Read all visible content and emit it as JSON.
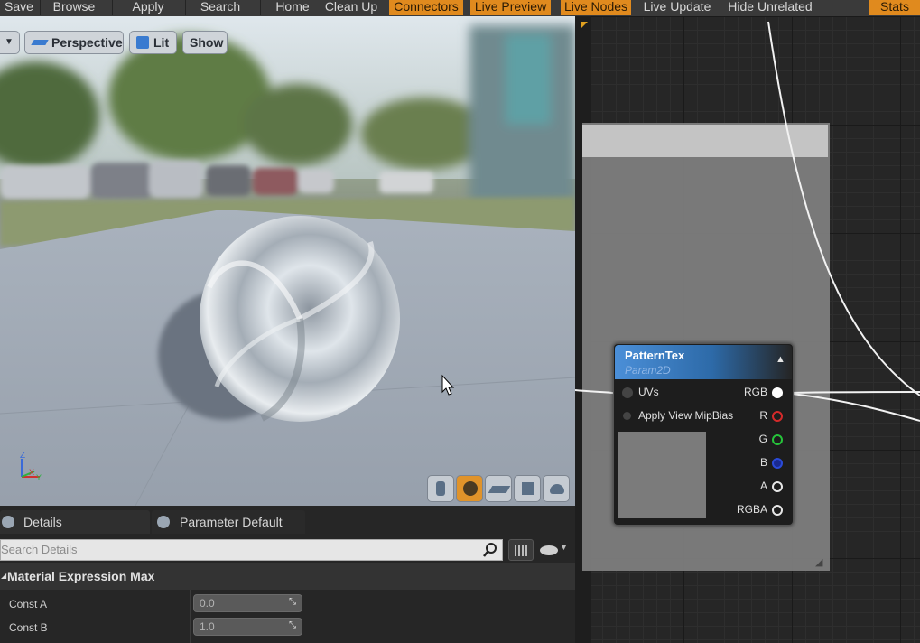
{
  "toolbar": {
    "buttons": [
      {
        "label": "Save",
        "active": false
      },
      {
        "label": "Browse",
        "active": false
      },
      {
        "label": "Apply",
        "active": false
      },
      {
        "label": "Search",
        "active": false
      },
      {
        "label": "Home",
        "active": false
      },
      {
        "label": "Clean Up",
        "active": false
      },
      {
        "label": "Connectors",
        "active": true
      },
      {
        "label": "Live Preview",
        "active": true
      },
      {
        "label": "Live Nodes",
        "active": true
      },
      {
        "label": "Live Update",
        "active": false
      },
      {
        "label": "Hide Unrelated",
        "active": false
      },
      {
        "label": "Stats",
        "active": true
      }
    ]
  },
  "viewport": {
    "perspective_label": "Perspective",
    "lit_label": "Lit",
    "show_label": "Show",
    "axis": {
      "z": "Z",
      "x": "X",
      "y": "Y"
    }
  },
  "details": {
    "tabs": [
      {
        "label": "Details"
      },
      {
        "label": "Parameter Default"
      }
    ],
    "search_placeholder": "Search Details",
    "section_title": "Material Expression Max",
    "properties": [
      {
        "label": "Const A",
        "value": "0.0"
      },
      {
        "label": "Const B",
        "value": "1.0"
      }
    ]
  },
  "graph": {
    "node": {
      "title": "PatternTex",
      "subtitle": "Param2D",
      "inputs": [
        "UVs",
        "Apply View MipBias"
      ],
      "outputs": [
        "RGB",
        "R",
        "G",
        "B",
        "A",
        "RGBA"
      ]
    }
  },
  "colors": {
    "toolbar_active": "#e08a1e",
    "pin_red": "#d42a2a",
    "pin_green": "#26c43a",
    "pin_blue": "#2a4ad8",
    "pin_white": "#ffffff",
    "node_header": "#2d6aa8"
  }
}
